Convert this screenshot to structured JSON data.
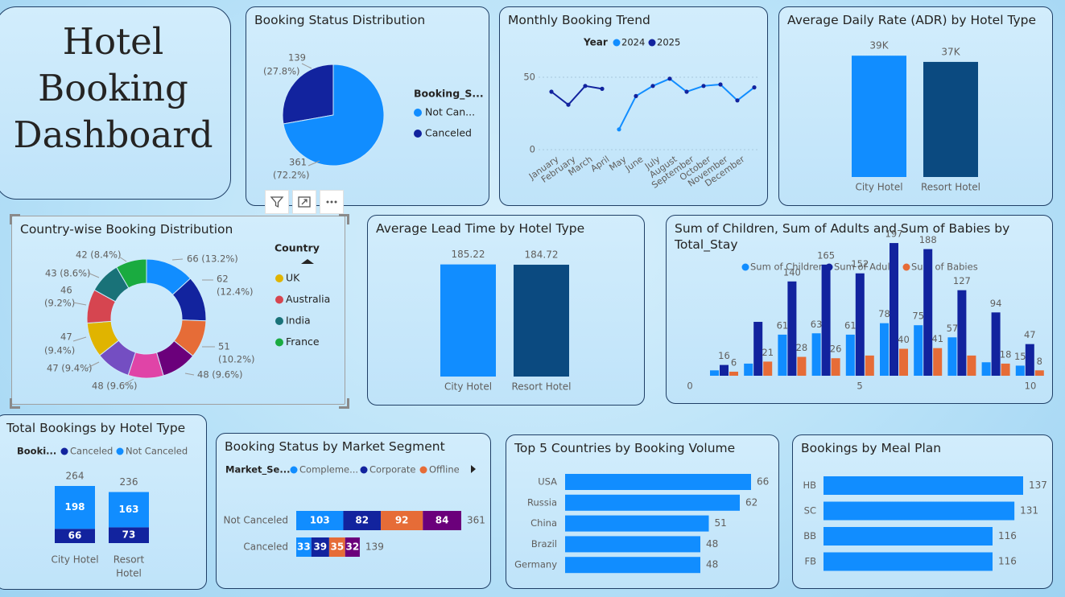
{
  "dashboard": {
    "title_lines": [
      "Hotel",
      "Booking",
      "Dashboard"
    ]
  },
  "colors": {
    "blue": "#118dff",
    "navy": "#12239e",
    "orange": "#e66c37",
    "purple": "#6b007b",
    "dark_blue": "#0b4a80",
    "mid_blue": "#1a8fe8"
  },
  "toolbar": {
    "icons": [
      "filter-icon",
      "focus-mode-icon",
      "more-options-icon"
    ]
  },
  "charts": {
    "booking_status": {
      "title": "Booking Status Distribution",
      "chart_data": {
        "type": "pie",
        "legend_title": "Booking_S...",
        "slices": [
          {
            "label": "Not Can...",
            "value": 361,
            "pct": "(72.2%)",
            "color": "#118dff"
          },
          {
            "label": "Canceled",
            "value": 139,
            "pct": "(27.8%)",
            "color": "#12239e"
          }
        ],
        "legend_position": "right"
      }
    },
    "monthly_trend": {
      "title": "Monthly Booking Trend",
      "chart_data": {
        "type": "line",
        "legend_title": "Year",
        "categories": [
          "January",
          "February",
          "March",
          "April",
          "May",
          "June",
          "July",
          "August",
          "September",
          "October",
          "November",
          "December"
        ],
        "series": [
          {
            "name": "2024",
            "color": "#118dff",
            "values": [
              null,
              null,
              null,
              null,
              14,
              37,
              44,
              49,
              40,
              44,
              45,
              34
            ]
          },
          {
            "name": "2025",
            "color": "#12239e",
            "values": [
              40,
              31,
              44,
              42,
              null,
              null,
              null,
              null,
              null,
              null,
              null,
              null
            ]
          }
        ],
        "combined_values": [
          40,
          31,
          44,
          42,
          14,
          37,
          44,
          49,
          40,
          44,
          45,
          34,
          43
        ],
        "y_ticks": [
          "0",
          "50"
        ],
        "ylim": [
          0,
          55
        ]
      }
    },
    "adr": {
      "title": "Average Daily Rate (ADR) by Hotel Type",
      "chart_data": {
        "type": "bar",
        "categories": [
          "City Hotel",
          "Resort Hotel"
        ],
        "values": [
          39000,
          37000
        ],
        "value_labels": [
          "39K",
          "37K"
        ],
        "colors": [
          "#118dff",
          "#0b4a80"
        ],
        "ylim": [
          0,
          45000
        ]
      }
    },
    "country_dist": {
      "title": "Country-wise Booking Distribution",
      "chart_data": {
        "type": "pie",
        "donut": true,
        "legend_title": "Country",
        "legend_items": [
          {
            "label": "UK",
            "color": "#e0b400"
          },
          {
            "label": "Australia",
            "color": "#d64550"
          },
          {
            "label": "India",
            "color": "#197278"
          },
          {
            "label": "France",
            "color": "#1aab40"
          }
        ],
        "slices": [
          {
            "value": 66,
            "label": "66 (13.2%)",
            "color": "#118dff"
          },
          {
            "value": 62,
            "label": "62 (12.4%)",
            "color": "#12239e"
          },
          {
            "value": 51,
            "label": "51 (10.2%)",
            "color": "#e66c37"
          },
          {
            "value": 48,
            "label": "48 (9.6%)",
            "color": "#6b007b"
          },
          {
            "value": 48,
            "label": "48 (9.6%)",
            "color": "#e044a7"
          },
          {
            "value": 47,
            "label": "47 (9.4%)",
            "color": "#744ec2"
          },
          {
            "value": 47,
            "label": "47 (9.4%)",
            "color": "#e0b400"
          },
          {
            "value": 46,
            "label": "46 (9.2%)",
            "color": "#d64550"
          },
          {
            "value": 43,
            "label": "43 (8.6%)",
            "color": "#197278"
          },
          {
            "value": 42,
            "label": "42 (8.4%)",
            "color": "#1aab40"
          }
        ]
      }
    },
    "lead_time": {
      "title": "Average Lead Time by Hotel Type",
      "chart_data": {
        "type": "bar",
        "categories": [
          "City Hotel",
          "Resort Hotel"
        ],
        "values": [
          185.22,
          184.72
        ],
        "value_labels": [
          "185.22",
          "184.72"
        ],
        "colors": [
          "#118dff",
          "#0b4a80"
        ],
        "ylim": [
          0,
          210
        ]
      }
    },
    "guests": {
      "title_line1": "Sum of Children, Sum of Adults and Sum of Babies by",
      "title_line2": "Total_Stay",
      "chart_data": {
        "type": "bar",
        "x": [
          1,
          2,
          3,
          4,
          5,
          6,
          7,
          8,
          9,
          10
        ],
        "x_ticks": [
          "0",
          "5",
          "10"
        ],
        "series": [
          {
            "name": "Sum of Children",
            "color": "#118dff",
            "values": [
              8,
              18,
              61,
              63,
              61,
              78,
              75,
              57,
              20,
              15
            ],
            "labels": [
              "",
              "",
              "61",
              "63",
              "61",
              "78",
              "75",
              "57",
              "",
              "15"
            ]
          },
          {
            "name": "Sum of Adults",
            "color": "#12239e",
            "values": [
              16,
              80,
              140,
              165,
              152,
              197,
              188,
              127,
              94,
              47
            ],
            "labels": [
              "16",
              "",
              "140",
              "165",
              "152",
              "197",
              "188",
              "127",
              "94",
              "47"
            ]
          },
          {
            "name": "Sum of Babies",
            "color": "#e66c37",
            "values": [
              6,
              21,
              28,
              26,
              30,
              40,
              41,
              30,
              18,
              8
            ],
            "labels": [
              "6",
              "21",
              "28",
              "26",
              "",
              "40",
              "41",
              "",
              "18",
              "8"
            ]
          }
        ],
        "ylim": [
          0,
          215
        ]
      }
    },
    "total_by_type": {
      "title": "Total Bookings by Hotel Type",
      "chart_data": {
        "type": "bar",
        "stacked": true,
        "legend_title": "Booki...",
        "categories": [
          "City Hotel",
          "Resort Hotel"
        ],
        "category_lines": [
          [
            "City Hotel"
          ],
          [
            "Resort",
            "Hotel"
          ]
        ],
        "series": [
          {
            "name": "Canceled",
            "color": "#12239e",
            "values": [
              66,
              73
            ]
          },
          {
            "name": "Not Canceled",
            "color": "#118dff",
            "values": [
              198,
              163
            ]
          }
        ],
        "totals": [
          264,
          236
        ],
        "ylim": [
          0,
          300
        ]
      }
    },
    "market_segment": {
      "title": "Booking Status by Market Segment",
      "chart_data": {
        "type": "bar",
        "orientation": "horizontal",
        "stacked": true,
        "legend_title": "Market_Se...",
        "categories": [
          "Not Canceled",
          "Canceled"
        ],
        "series": [
          {
            "name": "Compleme...",
            "color": "#118dff",
            "values": [
              103,
              33
            ]
          },
          {
            "name": "Corporate",
            "color": "#12239e",
            "values": [
              82,
              39
            ]
          },
          {
            "name": "Offline",
            "color": "#e66c37",
            "values": [
              92,
              35
            ]
          },
          {
            "name": "",
            "color": "#6b007b",
            "values": [
              84,
              32
            ]
          }
        ],
        "totals": [
          361,
          139
        ],
        "xlim": [
          0,
          361
        ]
      }
    },
    "top_countries": {
      "title": "Top 5 Countries by Booking Volume",
      "chart_data": {
        "type": "bar",
        "orientation": "horizontal",
        "categories": [
          "USA",
          "Russia",
          "China",
          "Brazil",
          "Germany"
        ],
        "values": [
          66,
          62,
          51,
          48,
          48
        ],
        "color": "#118dff",
        "xlim": [
          0,
          66
        ]
      }
    },
    "meal_plan": {
      "title": "Bookings by Meal Plan",
      "chart_data": {
        "type": "bar",
        "orientation": "horizontal",
        "categories": [
          "HB",
          "SC",
          "BB",
          "FB"
        ],
        "values": [
          137,
          131,
          116,
          116
        ],
        "color": "#118dff",
        "xlim": [
          0,
          137
        ]
      }
    }
  }
}
